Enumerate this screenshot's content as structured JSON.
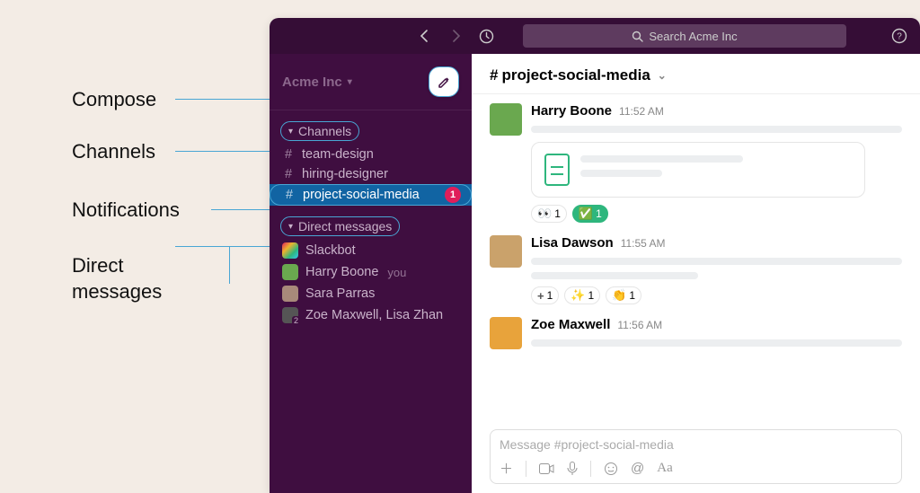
{
  "colors": {
    "sidebar_bg": "#3f0e40",
    "topbar_bg": "#350d36",
    "active_channel_bg": "#1164a3",
    "badge_bg": "#e01e5a",
    "annotation_line": "#49a6d4"
  },
  "annotations": {
    "compose": "Compose",
    "channels": "Channels",
    "notifications": "Notifications",
    "direct_messages": "Direct\nmessages"
  },
  "topbar": {
    "back_icon": "arrow-left",
    "forward_icon": "arrow-right",
    "history_icon": "clock",
    "search_placeholder": "Search Acme Inc",
    "help_icon": "question-circle"
  },
  "sidebar": {
    "workspace": {
      "name": "Acme Inc"
    },
    "compose_icon": "compose",
    "sections": {
      "channels": {
        "label": "Channels",
        "items": [
          {
            "name": "team-design",
            "active": false,
            "unread": 0
          },
          {
            "name": "hiring-designer",
            "active": false,
            "unread": 0
          },
          {
            "name": "project-social-media",
            "active": true,
            "unread": 1
          }
        ]
      },
      "direct_messages": {
        "label": "Direct messages",
        "items": [
          {
            "name": "Slackbot",
            "you": false
          },
          {
            "name": "Harry Boone",
            "you": true
          },
          {
            "name": "Sara Parras",
            "you": false
          },
          {
            "name": "Zoe Maxwell, Lisa Zhan",
            "you": false,
            "group_count": 2
          }
        ]
      }
    },
    "you_label": "you"
  },
  "channel": {
    "title_prefix": "#",
    "title": "project-social-media",
    "messages": [
      {
        "author": "Harry Boone",
        "time": "11:52 AM",
        "has_attachment": true,
        "reactions": [
          {
            "emoji": "👀",
            "count": 1
          },
          {
            "emoji": "✅",
            "count": 1,
            "style": "green"
          }
        ]
      },
      {
        "author": "Lisa Dawson",
        "time": "11:55 AM",
        "has_attachment": false,
        "reactions": [
          {
            "emoji": "+",
            "count": 1,
            "add": true
          },
          {
            "emoji": "✨",
            "count": 1
          },
          {
            "emoji": "👏",
            "count": 1
          }
        ]
      },
      {
        "author": "Zoe Maxwell",
        "time": "11:56 AM",
        "has_attachment": false,
        "reactions": []
      }
    ],
    "composer": {
      "placeholder": "Message #project-social-media",
      "icons": [
        "plus",
        "video",
        "mic",
        "emoji",
        "mention",
        "format"
      ]
    }
  }
}
